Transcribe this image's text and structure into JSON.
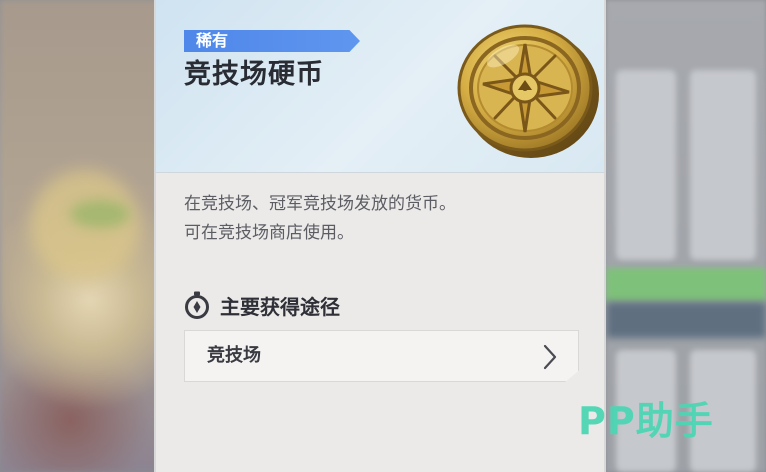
{
  "item": {
    "rarity": "稀有",
    "name": "竞技场硬币",
    "icon": "arena-coin-icon",
    "description": [
      "在竞技场、冠军竞技场发放的货币。",
      "可在竞技场商店使用。"
    ]
  },
  "sources": {
    "heading": "主要获得途径",
    "icon": "compass-icon",
    "items": [
      {
        "label": "竞技场",
        "icon": "chevron-right-icon"
      }
    ]
  },
  "watermark": "PP助手",
  "colors": {
    "rarity_tag": "#4f87ea",
    "header_bg": "#d8e8f2",
    "panel_bg": "#ebeae9",
    "watermark": "#4dd6b4",
    "coin_gold": "#c9a33c"
  }
}
